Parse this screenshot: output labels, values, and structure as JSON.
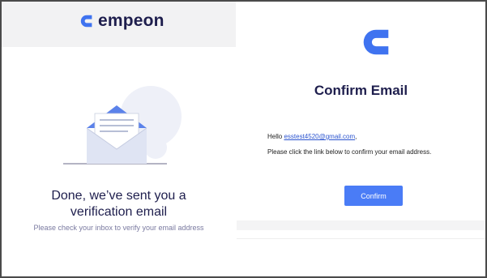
{
  "left": {
    "brand_name": "empeon",
    "title_line1": "Done, we’ve sent you a",
    "title_line2": "verification email",
    "subtitle": "Please check your inbox to verify your email address"
  },
  "right": {
    "title": "Confirm Email",
    "hello_prefix": "Hello ",
    "email": "esstest4520@gmail.com",
    "hello_suffix": ",",
    "instruction": "Please click the link below to confirm your email address.",
    "confirm_button": "Confirm"
  },
  "colors": {
    "brand": "#3f73f0",
    "navy_text": "#1e1e4d",
    "button": "#4a7cf6",
    "link": "#2b54cf"
  },
  "icons": [
    "empeon-logo-icon",
    "envelope-illustration-icon"
  ]
}
